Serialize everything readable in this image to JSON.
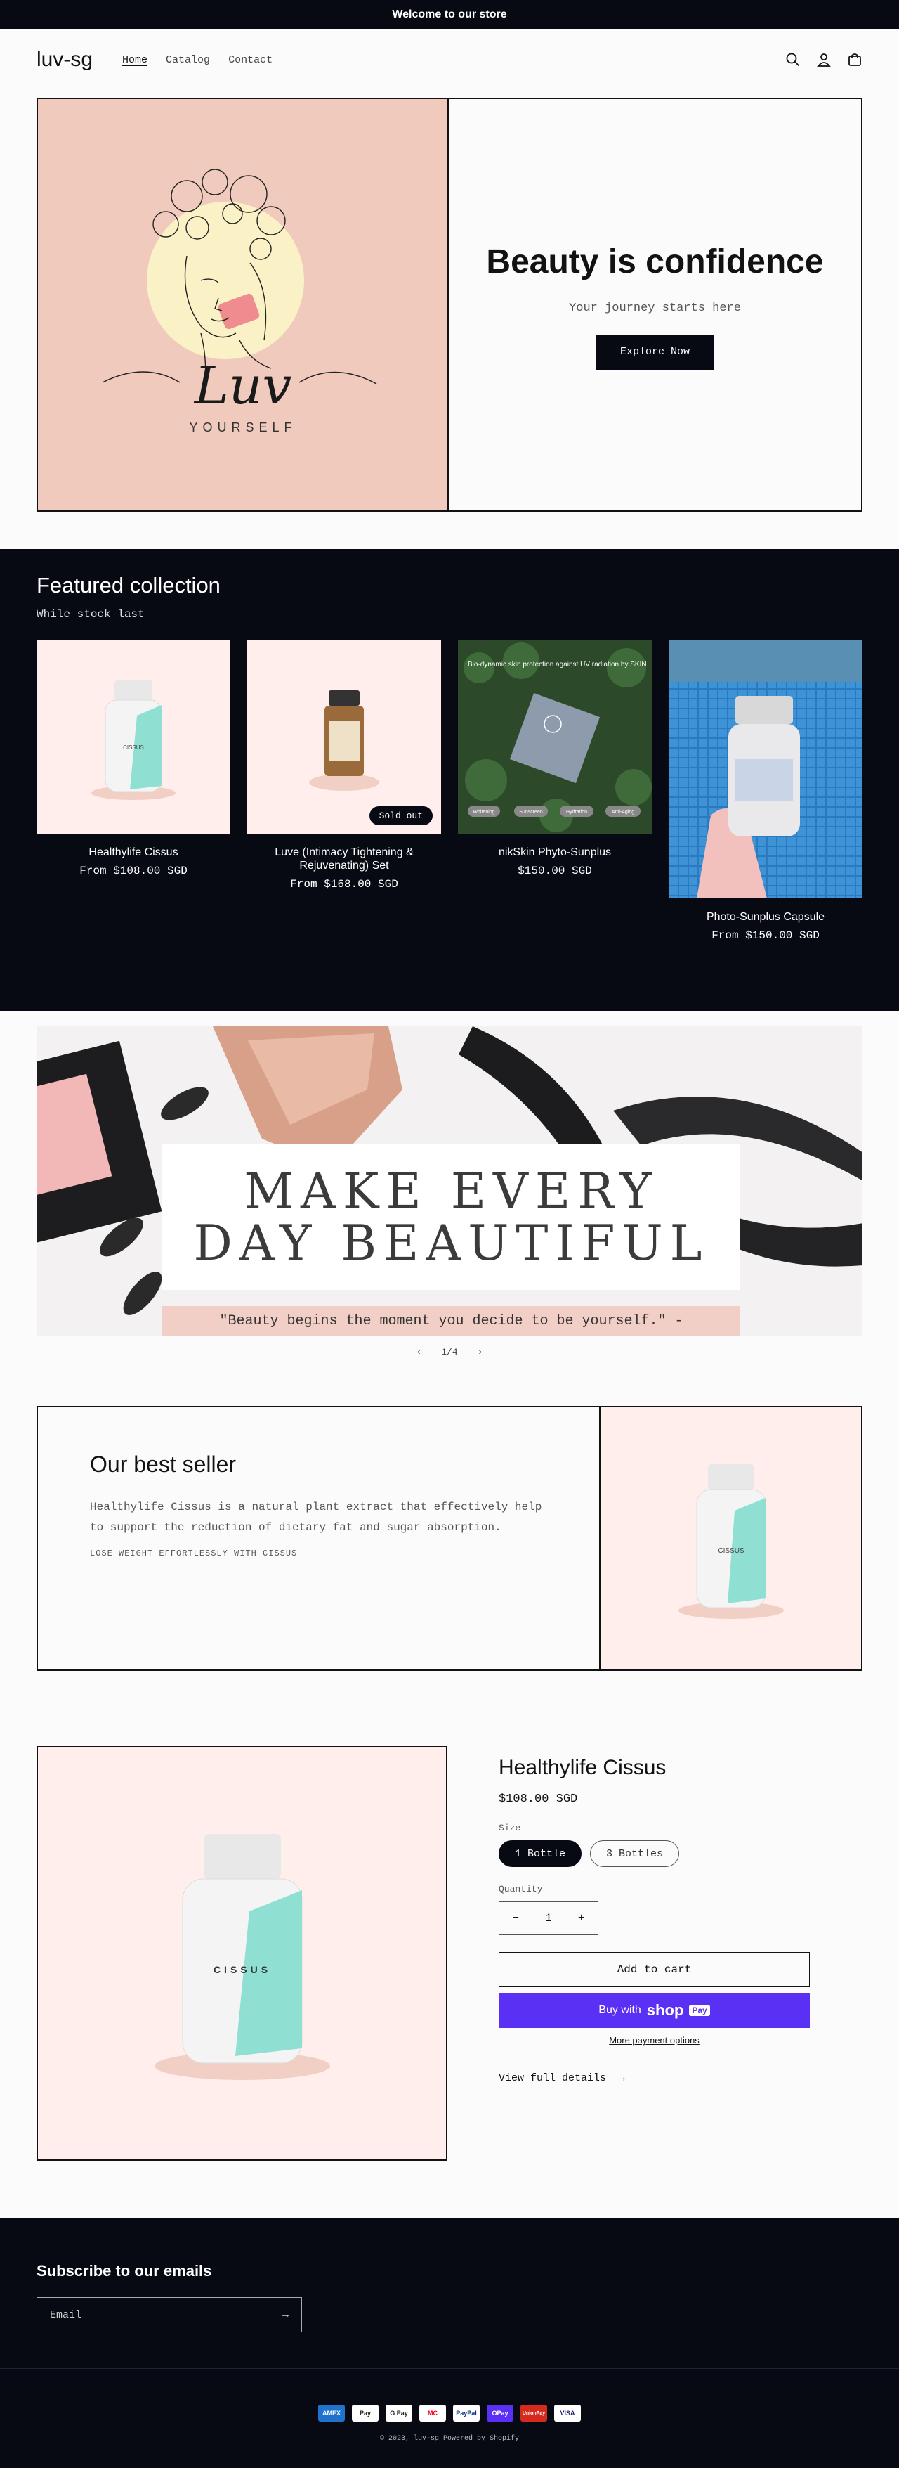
{
  "announcement": "Welcome to our store",
  "header": {
    "logo": "luv-sg",
    "nav": [
      "Home",
      "Catalog",
      "Contact"
    ],
    "icons": [
      "search-icon",
      "account-icon",
      "cart-icon"
    ]
  },
  "hero": {
    "art_script": "Luv",
    "art_caption": "YOURSELF",
    "title": "Beauty is confidence",
    "subtitle": "Your journey starts here",
    "button": "Explore Now"
  },
  "featured": {
    "title": "Featured collection",
    "subtitle": "While stock last",
    "products": [
      {
        "name": "Healthylife Cissus",
        "price": "From $108.00 SGD",
        "badge": ""
      },
      {
        "name": "Luve (Intimacy Tightening & Rejuvenating) Set",
        "price": "From $168.00 SGD",
        "badge": "Sold out"
      },
      {
        "name": "nikSkin Phyto-Sunplus",
        "price": "$150.00 SGD",
        "badge": ""
      },
      {
        "name": "Photo-Sunplus Capsule",
        "price": "From $150.00 SGD",
        "badge": ""
      }
    ],
    "photo_texts": {
      "banner": "Bio-dynamic skin protection against UV radiation by SKIN",
      "tags": [
        "Whitening",
        "Sunscreen",
        "Hydration",
        "Anti-Aging"
      ]
    }
  },
  "slideshow": {
    "headline_line1": "MAKE EVERY",
    "headline_line2": "DAY BEAUTIFUL",
    "quote": "\"Beauty begins the moment you decide to be yourself.\" -",
    "counter": "1/4"
  },
  "best_seller": {
    "title": "Our best seller",
    "text": "Healthylife Cissus is a natural plant extract that effectively help to support the reduction of dietary fat and sugar absorption.",
    "caption": "LOSE WEIGHT EFFORTLESSLY WITH CISSUS"
  },
  "product": {
    "title": "Healthylife Cissus",
    "price": "$108.00 SGD",
    "size_label": "Size",
    "sizes": [
      "1 Bottle",
      "3 Bottles"
    ],
    "quantity_label": "Quantity",
    "quantity": "1",
    "add_to_cart": "Add to cart",
    "buy_with": "Buy with",
    "shop_pay": "shop",
    "shop_pay_badge": "Pay",
    "more_payment": "More payment options",
    "view_details": "View full details",
    "bottle_label": "CISSUS"
  },
  "footer": {
    "subscribe_title": "Subscribe to our emails",
    "email_placeholder": "Email",
    "payment_icons": [
      "AMEX",
      "Pay",
      "G Pay",
      "MC",
      "PayPal",
      "OPay",
      "UnionPay",
      "VISA"
    ],
    "copyright": "© 2023, luv-sg Powered by Shopify"
  }
}
